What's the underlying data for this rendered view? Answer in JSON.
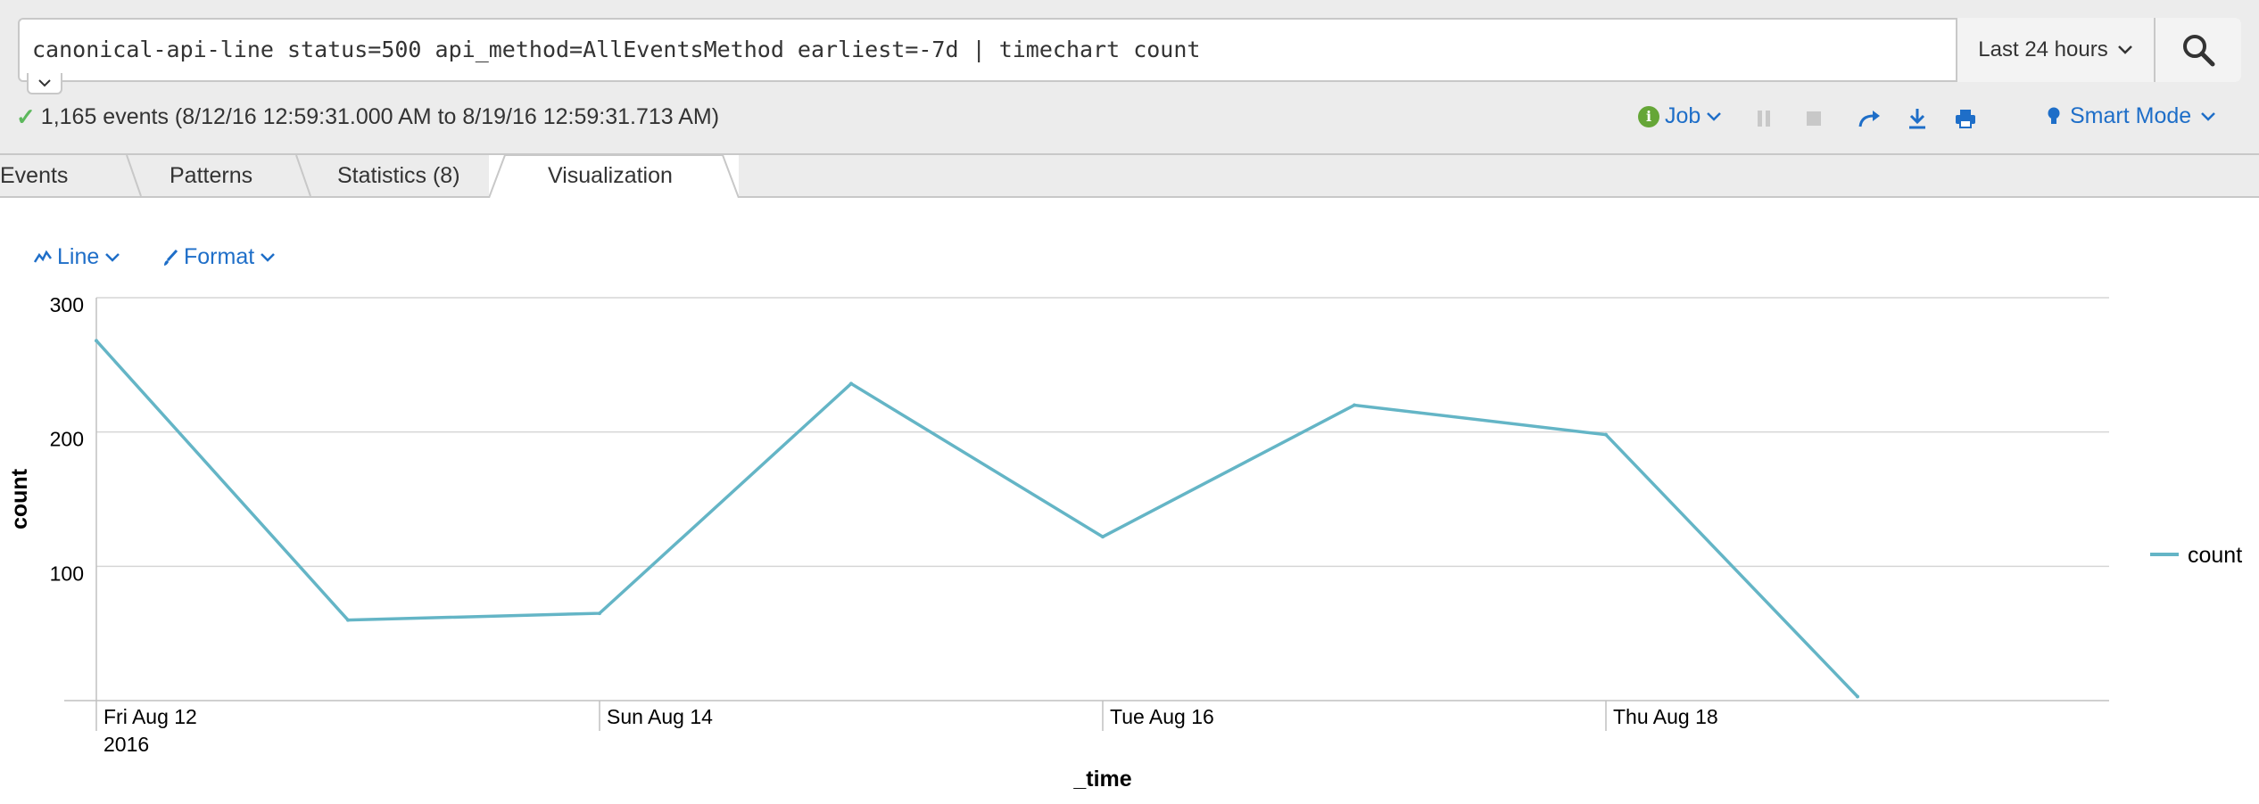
{
  "search": {
    "query": "canonical-api-line status=500 api_method=AllEventsMethod earliest=-7d | timechart count",
    "time_range": "Last 24 hours"
  },
  "status": {
    "summary": "1,165 events (8/12/16 12:59:31.000 AM to 8/19/16 12:59:31.713 AM)"
  },
  "job_bar": {
    "job_label": "Job",
    "mode_label": "Smart Mode"
  },
  "tabs": [
    {
      "label": "Events",
      "active": false
    },
    {
      "label": "Patterns",
      "active": false
    },
    {
      "label": "Statistics (8)",
      "active": false
    },
    {
      "label": "Visualization",
      "active": true
    }
  ],
  "viz_toolbar": {
    "chart_type_label": "Line",
    "format_label": "Format"
  },
  "colors": {
    "series": "#64b5c6",
    "link": "#1e6ec8",
    "success": "#5cb85c"
  },
  "chart_data": {
    "type": "line",
    "xlabel": "_time",
    "ylabel": "count",
    "x": [
      "2016-08-12",
      "2016-08-13",
      "2016-08-14",
      "2016-08-15",
      "2016-08-16",
      "2016-08-17",
      "2016-08-18",
      "2016-08-19"
    ],
    "x_tick_labels": [
      {
        "date": "2016-08-12",
        "label": "Fri Aug 12",
        "sub": "2016"
      },
      {
        "date": "2016-08-14",
        "label": "Sun Aug 14",
        "sub": ""
      },
      {
        "date": "2016-08-16",
        "label": "Tue Aug 16",
        "sub": ""
      },
      {
        "date": "2016-08-18",
        "label": "Thu Aug 18",
        "sub": ""
      }
    ],
    "series": [
      {
        "name": "count",
        "values": [
          268,
          60,
          65,
          236,
          122,
          220,
          198,
          3
        ]
      }
    ],
    "ylim": [
      0,
      300
    ],
    "y_ticks": [
      100,
      200,
      300
    ],
    "grid": true,
    "legend_position": "right"
  }
}
